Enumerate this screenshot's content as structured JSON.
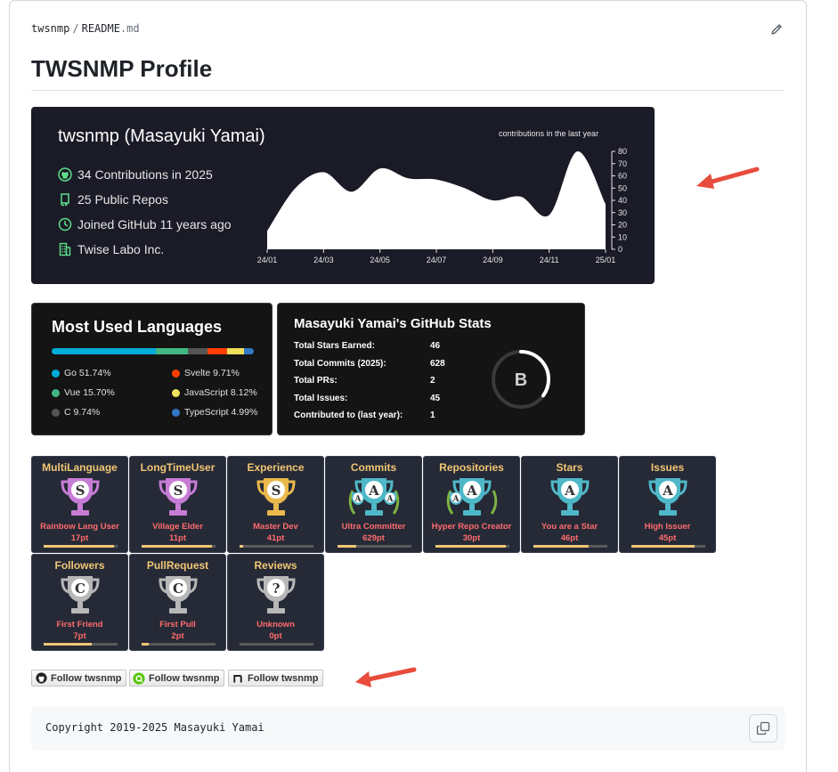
{
  "breadcrumb": {
    "owner": "twsnmp",
    "separator": "/",
    "file": "README",
    "ext": ".md"
  },
  "page_title": "TWSNMP Profile",
  "profile_card": {
    "name": "twsnmp (Masayuki Yamai)",
    "rows": [
      {
        "icon": "github-icon",
        "text": "34 Contributions in 2025"
      },
      {
        "icon": "repo-icon",
        "text": "25 Public Repos"
      },
      {
        "icon": "clock-icon",
        "text": "Joined GitHub 11 years ago"
      },
      {
        "icon": "building-icon",
        "text": "Twise Labo Inc."
      }
    ],
    "chart_title": "contributions in the last year",
    "accent": "#5ee08a"
  },
  "chart_data": {
    "type": "area",
    "title": "contributions in the last year",
    "x_ticks": [
      "24/01",
      "24/03",
      "24/05",
      "24/07",
      "24/09",
      "24/11",
      "25/01"
    ],
    "x": [
      "24/01",
      "24/02",
      "24/03",
      "24/04",
      "24/05",
      "24/06",
      "24/07",
      "24/08",
      "24/09",
      "24/10",
      "24/11",
      "24/12",
      "25/01"
    ],
    "values": [
      15,
      50,
      63,
      47,
      66,
      58,
      57,
      50,
      40,
      43,
      28,
      80,
      37
    ],
    "y_ticks": [
      0,
      10,
      20,
      30,
      40,
      50,
      60,
      70,
      80
    ],
    "ylim": [
      0,
      80
    ],
    "color": "#ffffff"
  },
  "languages": {
    "title": "Most Used Languages",
    "items": [
      {
        "name": "Go",
        "pct": "51.74%",
        "value": 51.74,
        "color": "#00add8"
      },
      {
        "name": "Vue",
        "pct": "15.70%",
        "value": 15.7,
        "color": "#41b883"
      },
      {
        "name": "C",
        "pct": "9.74%",
        "value": 9.74,
        "color": "#555555"
      },
      {
        "name": "Svelte",
        "pct": "9.71%",
        "value": 9.71,
        "color": "#ff3e00"
      },
      {
        "name": "JavaScript",
        "pct": "8.12%",
        "value": 8.12,
        "color": "#f1e05a"
      },
      {
        "name": "TypeScript",
        "pct": "4.99%",
        "value": 4.99,
        "color": "#3178c6"
      }
    ]
  },
  "stats": {
    "title": "Masayuki Yamai's GitHub Stats",
    "rows": [
      {
        "label": "Total Stars Earned:",
        "value": "46"
      },
      {
        "label": "Total Commits (2025):",
        "value": "628"
      },
      {
        "label": "Total PRs:",
        "value": "2"
      },
      {
        "label": "Total Issues:",
        "value": "45"
      },
      {
        "label": "Contributed to (last year):",
        "value": "1"
      }
    ],
    "rank": "B",
    "rank_progress": 0.35
  },
  "trophies": [
    {
      "title": "MultiLanguage",
      "rank": "S",
      "name": "Rainbow Lang User",
      "pt": "17pt",
      "progress": 0.95,
      "cup": "#c77dd6"
    },
    {
      "title": "LongTimeUser",
      "rank": "S",
      "name": "Village Elder",
      "pt": "11pt",
      "progress": 0.95,
      "cup": "#c77dd6"
    },
    {
      "title": "Experience",
      "rank": "S",
      "name": "Master Dev",
      "pt": "41pt",
      "progress": 0.05,
      "cup": "#e9b94c"
    },
    {
      "title": "Commits",
      "rank": "AAA",
      "name": "Ultra Committer",
      "pt": "629pt",
      "progress": 0.25,
      "cup": "#4fb8c8"
    },
    {
      "title": "Repositories",
      "rank": "AA",
      "name": "Hyper Repo Creator",
      "pt": "30pt",
      "progress": 0.95,
      "cup": "#4fb8c8"
    },
    {
      "title": "Stars",
      "rank": "A",
      "name": "You are a Star",
      "pt": "46pt",
      "progress": 0.75,
      "cup": "#4fb8c8"
    },
    {
      "title": "Issues",
      "rank": "A",
      "name": "High Issuer",
      "pt": "45pt",
      "progress": 0.85,
      "cup": "#4fb8c8"
    },
    {
      "title": "Followers",
      "rank": "C",
      "name": "First Friend",
      "pt": "7pt",
      "progress": 0.65,
      "cup": "#b8b8b8"
    },
    {
      "title": "PullRequest",
      "rank": "C",
      "name": "First Pull",
      "pt": "2pt",
      "progress": 0.1,
      "cup": "#b8b8b8"
    },
    {
      "title": "Reviews",
      "rank": "?",
      "name": "Unknown",
      "pt": "0pt",
      "progress": 0.0,
      "cup": "#b8b8b8"
    }
  ],
  "follow_badges": [
    {
      "icon": "github-icon",
      "label": "Follow twsnmp"
    },
    {
      "icon": "qiita-icon",
      "label": "Follow twsnmp"
    },
    {
      "icon": "note-icon",
      "label": "Follow twsnmp"
    }
  ],
  "code_block": {
    "text": "Copyright 2019-2025 Masayuki Yamai"
  },
  "annotation_color": "#e74c3c"
}
